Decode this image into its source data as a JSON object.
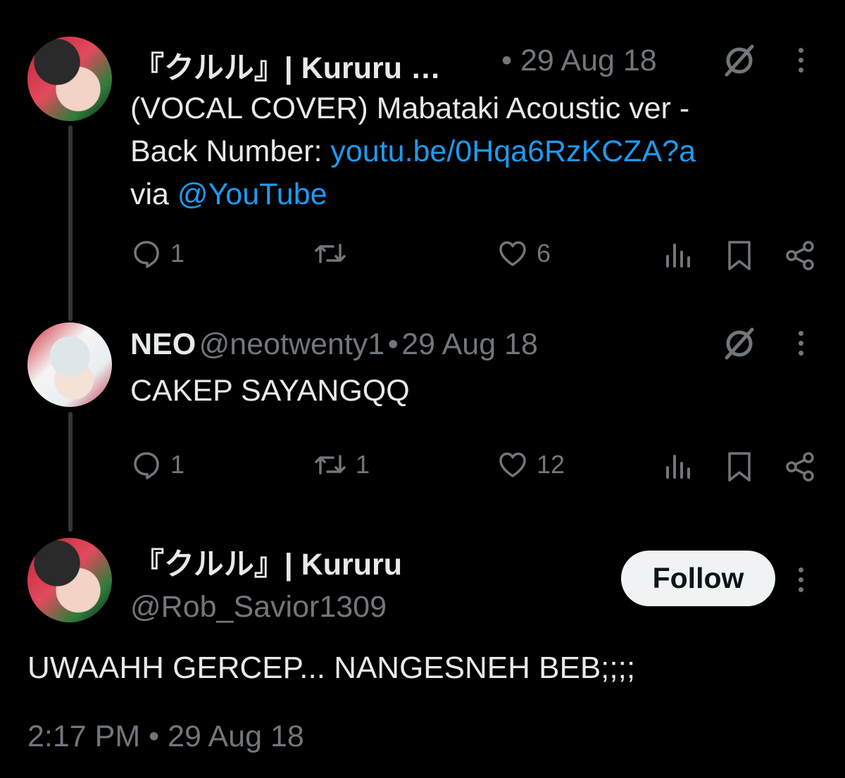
{
  "tweet1": {
    "display_name": "『クルル』| Kururu …",
    "separator": "•",
    "date": "29 Aug 18",
    "text_line1": "(VOCAL COVER) Mabataki Acoustic ver -",
    "text_line2_prefix": "Back Number: ",
    "link": "youtu.be/0Hqa6RzKCZA?a",
    "text_line3_prefix": "via ",
    "mention": "@YouTube",
    "replies": "1",
    "retweets": "",
    "likes": "6"
  },
  "tweet2": {
    "display_name": "NEO",
    "handle": "@neotwenty1",
    "separator": "•",
    "date": "29 Aug 18",
    "text": "CAKEP SAYANGQQ",
    "replies": "1",
    "retweets": "1",
    "likes": "12"
  },
  "main_tweet": {
    "display_name": "『クルル』| Kururu",
    "handle": "@Rob_Savior1309",
    "follow_label": "Follow",
    "text": "UWAAHH GERCEP... NANGESNEH BEB;;;;",
    "timestamp": "2:17 PM • 29 Aug 18"
  },
  "icons": {
    "reply": "reply-icon",
    "retweet": "retweet-icon",
    "like": "heart-icon",
    "views": "analytics-icon",
    "bookmark": "bookmark-icon",
    "share": "share-icon",
    "grok": "grok-icon",
    "more": "more-icon"
  },
  "colors": {
    "background": "#000000",
    "text": "#e7e9ea",
    "secondary": "#71767b",
    "link": "#1d9bf0",
    "follow_bg": "#eff3f4"
  }
}
